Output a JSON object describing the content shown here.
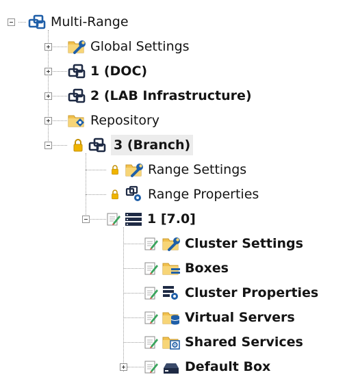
{
  "tree": {
    "root": {
      "label": "Multi-Range",
      "icon": "range-group-icon"
    },
    "global_settings": {
      "label": "Global Settings",
      "icon": "folder-wrench-icon"
    },
    "doc": {
      "label": "1 (DOC)",
      "icon": "range-group-icon"
    },
    "lab": {
      "label": "2 (LAB Infrastructure)",
      "icon": "range-group-icon"
    },
    "repository": {
      "label": "Repository",
      "icon": "folder-repository-icon"
    },
    "branch": {
      "label": "3 (Branch)",
      "icon": "range-group-icon",
      "range_settings": {
        "label": "Range Settings",
        "icon": "folder-wrench-icon"
      },
      "range_properties": {
        "label": "Range Properties",
        "icon": "range-properties-icon"
      },
      "cluster": {
        "label": "1 [7.0]",
        "icon": "server-stack-icon",
        "children": [
          {
            "label": "Cluster Settings",
            "icon": "folder-wrench-icon"
          },
          {
            "label": "Boxes",
            "icon": "folder-boxes-icon"
          },
          {
            "label": "Cluster Properties",
            "icon": "cluster-properties-icon"
          },
          {
            "label": "Virtual Servers",
            "icon": "folder-database-icon"
          },
          {
            "label": "Shared Services",
            "icon": "folder-gear-icon"
          },
          {
            "label": "Default Box",
            "icon": "box-icon"
          }
        ]
      }
    }
  },
  "colors": {
    "accent_blue": "#1f5fa8",
    "dark_navy": "#1e2a44",
    "folder_yellow": "#f2c14e",
    "lock_gold": "#e0a800",
    "edit_green": "#3aa55d",
    "selection_bg": "#ececec"
  }
}
